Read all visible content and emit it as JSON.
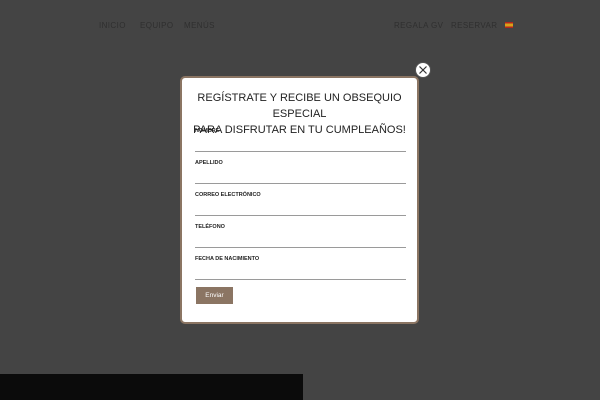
{
  "nav": {
    "left_items": [
      "INICIO",
      "EQUIPO",
      "MENÚS"
    ],
    "right_items": [
      "REGALA GV",
      "RESERVAR"
    ],
    "language_flag": "spain-flag-icon"
  },
  "modal": {
    "title_line1": "REGÍSTRATE Y RECIBE UN OBSEQUIO ESPECIAL",
    "title_line2": "PARA DISFRUTAR EN TU CUMPLEAÑOS!",
    "fields": [
      {
        "label": "NOMBRE",
        "value": ""
      },
      {
        "label": "APELLIDO",
        "value": ""
      },
      {
        "label": "CORREO ELECTRÓNICO",
        "value": ""
      },
      {
        "label": "TELÉFONO",
        "value": ""
      },
      {
        "label": "FECHA DE NACIMIENTO",
        "value": ""
      }
    ],
    "submit_label": "Enviar",
    "close_icon": "close-icon"
  },
  "colors": {
    "overlay": "#444444",
    "accent": "#8b7563",
    "modal_bg": "#ffffff"
  }
}
